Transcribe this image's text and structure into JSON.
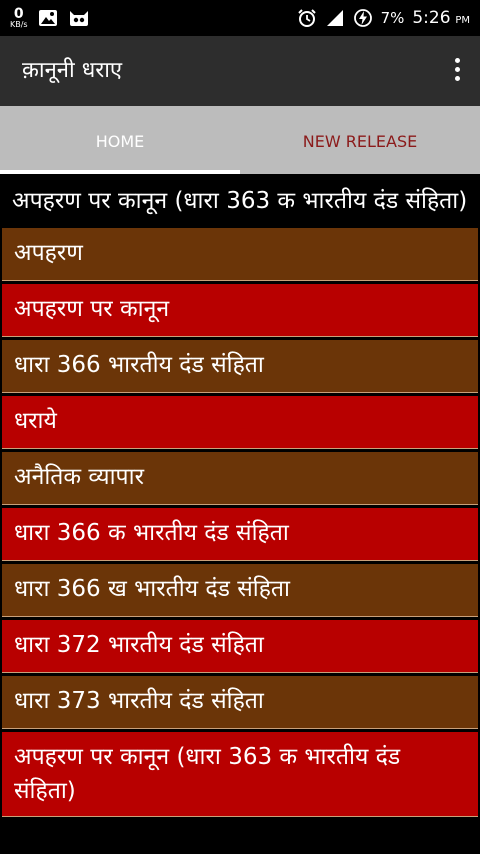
{
  "status_bar": {
    "net_speed_value": "0",
    "net_speed_unit": "KB/s",
    "battery": "7%",
    "time": "5:26",
    "time_suffix": "PM"
  },
  "app_bar": {
    "title": "क़ानूनी धराए"
  },
  "tabs": [
    {
      "label": "HOME",
      "selected": true
    },
    {
      "label": "NEW RELEASE",
      "selected": false
    }
  ],
  "list": {
    "items": [
      {
        "text": "अपहरण पर कानून (धारा 363 क भारतीय दंड संहिता)",
        "style": "black"
      },
      {
        "text": "अपहरण",
        "style": "brown"
      },
      {
        "text": "अपहरण पर कानून",
        "style": "red"
      },
      {
        "text": "धारा 366 भारतीय दंड संहिता",
        "style": "brown"
      },
      {
        "text": "धराये",
        "style": "red"
      },
      {
        "text": "अनैतिक व्यापार",
        "style": "brown"
      },
      {
        "text": "धारा 366 क भारतीय दंड संहिता",
        "style": "red"
      },
      {
        "text": "धारा 366 ख भारतीय दंड संहिता",
        "style": "brown"
      },
      {
        "text": "धारा 372 भारतीय दंड संहिता",
        "style": "red"
      },
      {
        "text": "धारा 373 भारतीय दंड संहिता",
        "style": "brown"
      },
      {
        "text": "अपहरण पर कानून (धारा 363 क भारतीय दंड संहिता)",
        "style": "red"
      }
    ]
  },
  "colors": {
    "list_brown": "#6b3508",
    "list_red": "#b80000",
    "tab_bar": "#bcbcbc",
    "new_release_text": "#8b1a1a",
    "app_bar": "#2d2d2d"
  }
}
